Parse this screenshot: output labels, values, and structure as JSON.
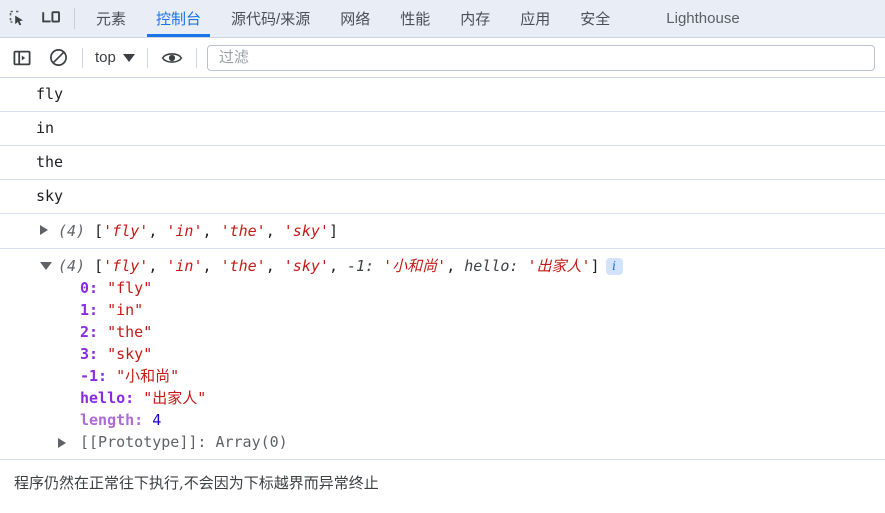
{
  "titlebar": {
    "inspect_icon": "inspect-element-icon",
    "device_icon": "device-toolbar-icon",
    "tabs": [
      {
        "label": "元素",
        "active": false
      },
      {
        "label": "控制台",
        "active": true
      },
      {
        "label": "源代码/来源",
        "active": false
      },
      {
        "label": "网络",
        "active": false
      },
      {
        "label": "性能",
        "active": false
      },
      {
        "label": "内存",
        "active": false
      },
      {
        "label": "应用",
        "active": false
      },
      {
        "label": "安全",
        "active": false
      },
      {
        "label": "Lighthouse",
        "active": false
      }
    ],
    "accent_color": "#1a73e8",
    "background_color": "#e9eef6"
  },
  "toolbar": {
    "sidebar_toggle_icon": "show-console-sidebar-icon",
    "clear_icon": "clear-console-icon",
    "context_value": "top",
    "caret_icon": "chevron-down-icon",
    "eye_icon": "live-expression-eye-icon",
    "filter_placeholder": "过滤",
    "filter_value": ""
  },
  "console": {
    "log_rows": [
      {
        "text": "fly"
      },
      {
        "text": "in"
      },
      {
        "text": "the"
      },
      {
        "text": "sky"
      }
    ],
    "collapsed_array": {
      "arrow": "disclosure-triangle-right",
      "length_label": "(4)",
      "open_bracket": "[",
      "items": [
        "'fly'",
        "'in'",
        "'the'",
        "'sky'"
      ],
      "separator": ", ",
      "close_bracket": "]"
    },
    "expanded_array": {
      "arrow": "disclosure-triangle-down",
      "length_label": "(4)",
      "open_bracket": "[",
      "items": [
        "'fly'",
        "'in'",
        "'the'",
        "'sky'"
      ],
      "separator": ", ",
      "extra": [
        {
          "key": "-1:",
          "value": "'小和尚'"
        },
        {
          "key": "hello:",
          "value": "'出家人'"
        }
      ],
      "close_bracket": "]",
      "info_badge": "i",
      "properties": [
        {
          "key": "0:",
          "value": "\"fly\"",
          "type": "string",
          "dim": false
        },
        {
          "key": "1:",
          "value": "\"in\"",
          "type": "string",
          "dim": false
        },
        {
          "key": "2:",
          "value": "\"the\"",
          "type": "string",
          "dim": false
        },
        {
          "key": "3:",
          "value": "\"sky\"",
          "type": "string",
          "dim": false
        },
        {
          "key": "-1:",
          "value": "\"小和尚\"",
          "type": "string",
          "dim": false
        },
        {
          "key": "hello:",
          "value": "\"出家人\"",
          "type": "string",
          "dim": false
        },
        {
          "key": "length:",
          "value": "4",
          "type": "number",
          "dim": true
        }
      ],
      "prototype": {
        "arrow": "disclosure-triangle-right",
        "key": "[[Prototype]]:",
        "value": "Array(0)"
      }
    },
    "note": "程序仍然在正常往下执行,不会因为下标越界而异常终止"
  }
}
